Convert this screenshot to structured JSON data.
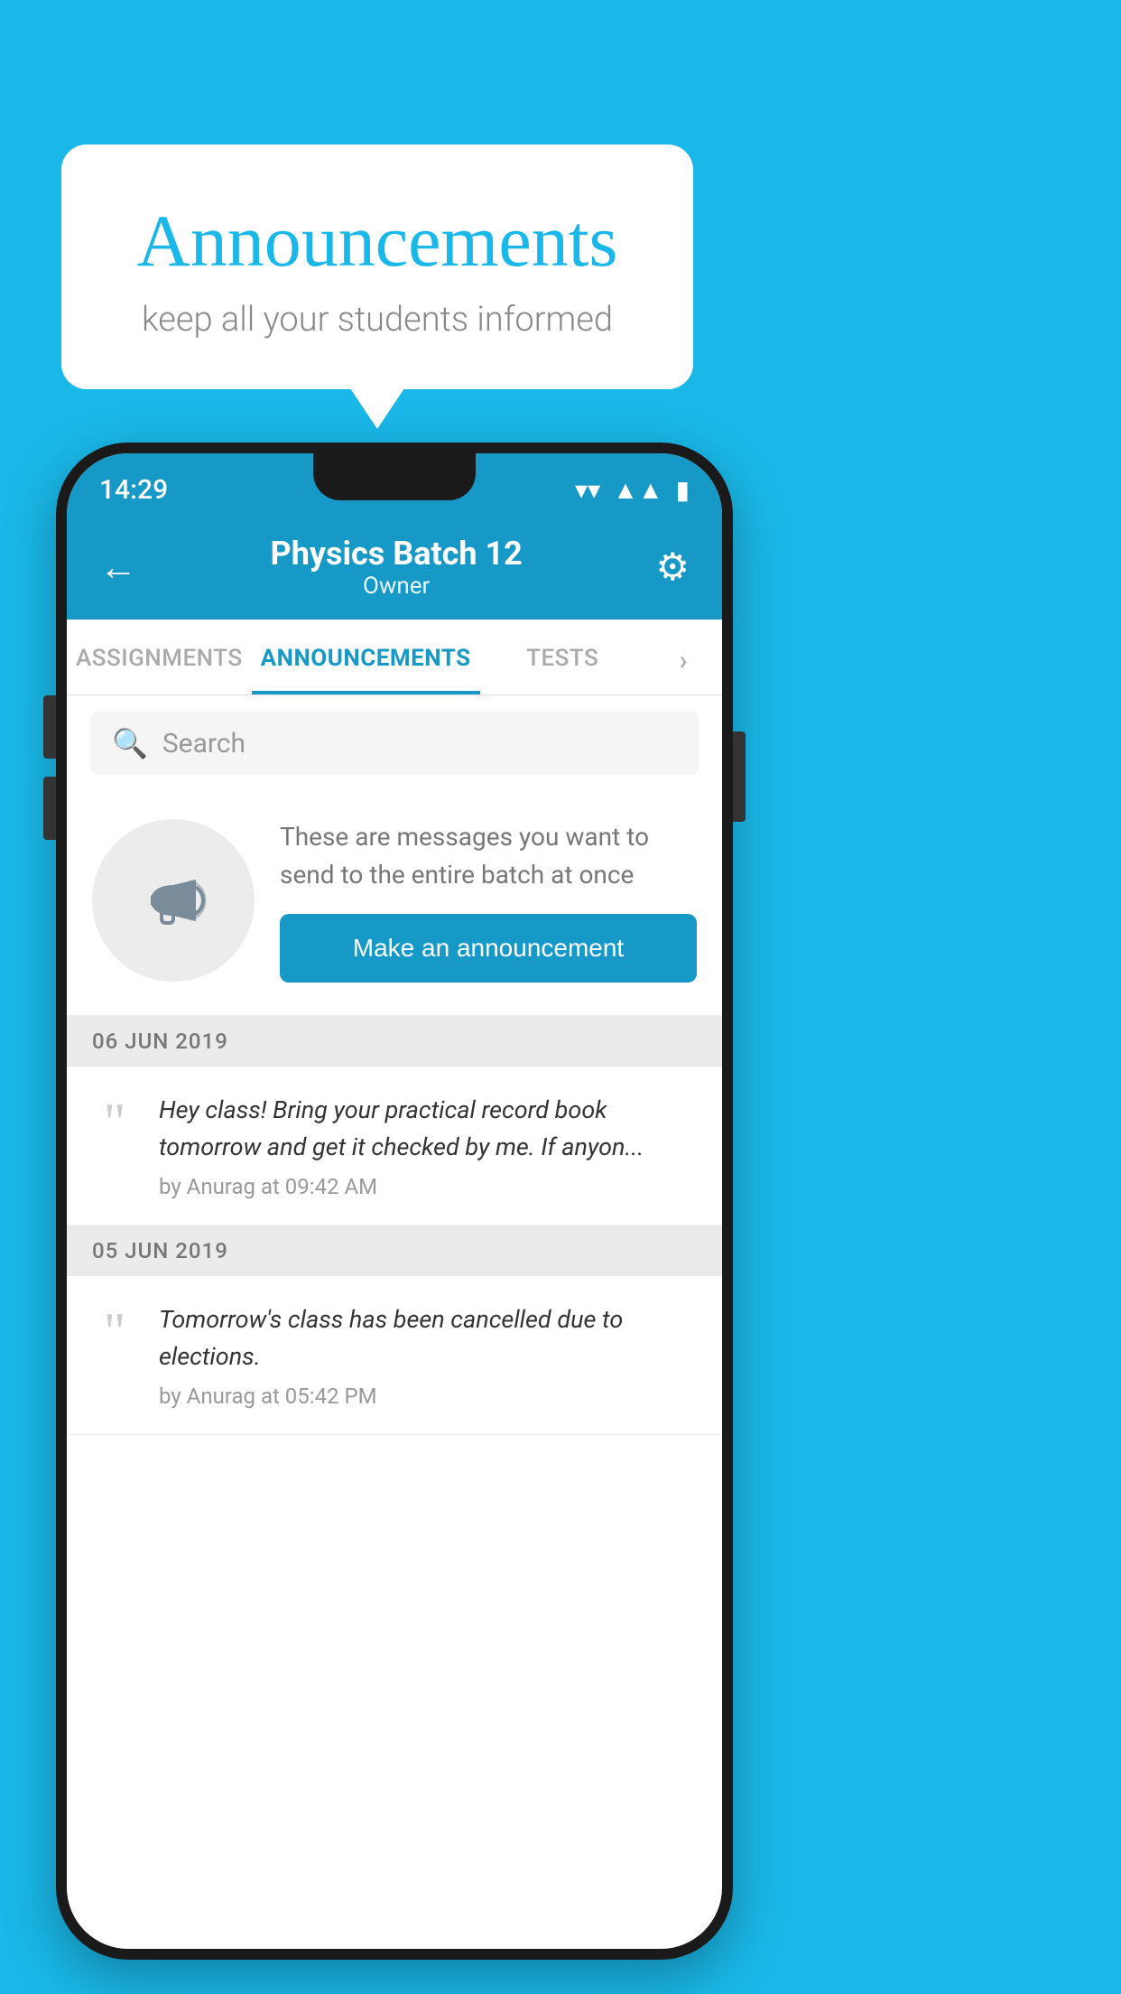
{
  "background_color": "#1ab8e8",
  "bubble": {
    "title": "Announcements",
    "subtitle": "keep all your students informed"
  },
  "phone": {
    "status_bar": {
      "time": "14:29"
    },
    "header": {
      "title": "Physics Batch 12",
      "subtitle": "Owner",
      "back_label": "←",
      "gear_label": "⚙"
    },
    "tabs": [
      {
        "label": "ASSIGNMENTS",
        "active": false
      },
      {
        "label": "ANNOUNCEMENTS",
        "active": true
      },
      {
        "label": "TESTS",
        "active": false
      },
      {
        "label": "›",
        "active": false
      }
    ],
    "search": {
      "placeholder": "Search"
    },
    "promo": {
      "description": "These are messages you want to send to the entire batch at once",
      "button_label": "Make an announcement"
    },
    "announcements": [
      {
        "date": "06  JUN  2019",
        "text": "Hey class! Bring your practical record book tomorrow and get it checked by me. If anyon...",
        "meta": "by Anurag at 09:42 AM"
      },
      {
        "date": "05  JUN  2019",
        "text": "Tomorrow's class has been cancelled due to elections.",
        "meta": "by Anurag at 05:42 PM"
      }
    ]
  }
}
